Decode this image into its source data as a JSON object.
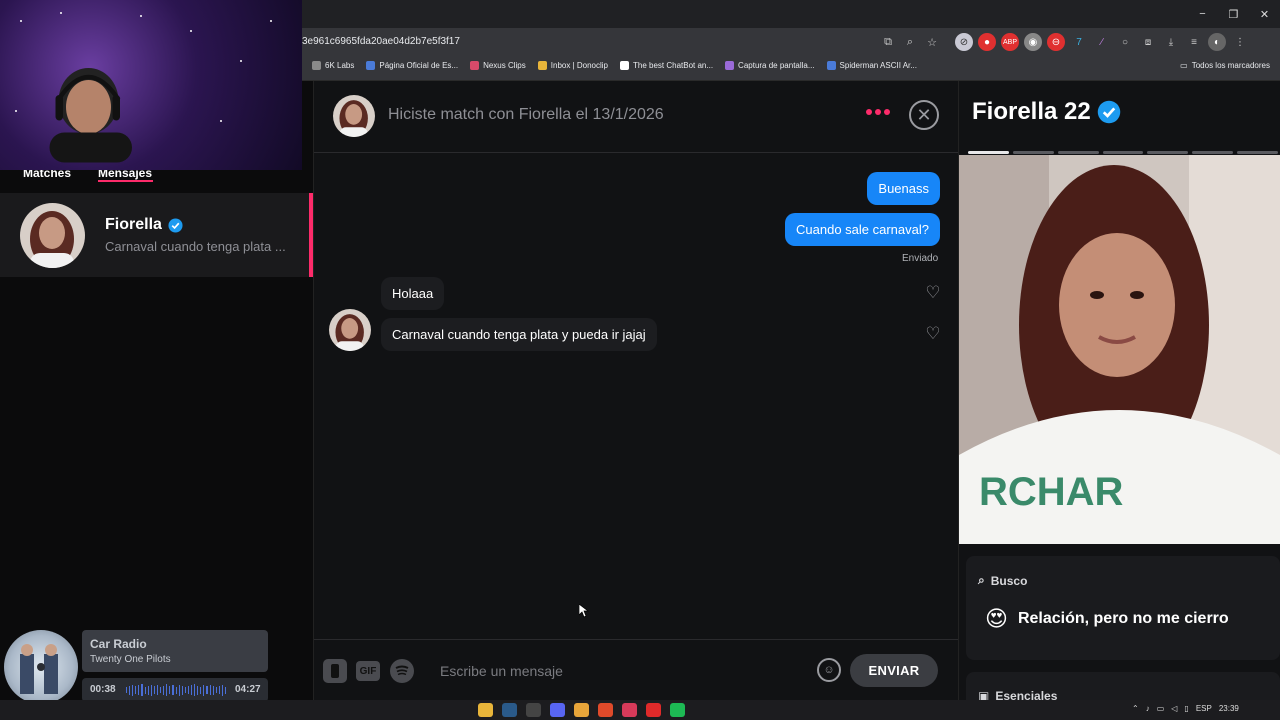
{
  "browser": {
    "url": "3e961c6965fda20ae04d2b7e5f3f17",
    "bookmarks": [
      {
        "label": "6K Labs",
        "color": "#8a8a8a"
      },
      {
        "label": "Página Oficial de Es...",
        "color": "#4a7bd8"
      },
      {
        "label": "Nexus Clips",
        "color": "#d84a6a"
      },
      {
        "label": "Inbox | Donoclip",
        "color": "#e8b53a"
      },
      {
        "label": "The best ChatBot an...",
        "color": "#ffffff"
      },
      {
        "label": "Captura de pantalla...",
        "color": "#9a6ad8"
      },
      {
        "label": "Spiderman ASCII Ar...",
        "color": "#4a7bd8"
      }
    ],
    "all_bookmarks": "Todos los marcadores",
    "window_controls": [
      "−",
      "❐",
      "✕"
    ]
  },
  "sidebar": {
    "tabs": {
      "matches": "Matches",
      "messages": "Mensajes"
    },
    "active_tab": "Mensajes",
    "conversation": {
      "name": "Fiorella",
      "verified": true,
      "preview": "Carnaval cuando tenga plata ..."
    }
  },
  "music": {
    "title": "Car Radio",
    "artist": "Twenty One Pilots",
    "current_time": "00:38",
    "total_time": "04:27",
    "progress": 0.14
  },
  "chat": {
    "header": "Hiciste match con Fiorella el 13/1/2026",
    "messages_out": [
      "Buenass",
      "Cuando sale carnaval?"
    ],
    "sent_status": "Enviado",
    "messages_in": [
      "Holaaa",
      "Carnaval cuando tenga plata y pueda ir jajaj"
    ],
    "composer": {
      "placeholder": "Escribe un mensaje",
      "send_label": "ENVIAR",
      "gif_label": "GIF"
    }
  },
  "profile": {
    "name_age": "Fiorella 22",
    "verified": true,
    "photo_count": 7,
    "active_photo": 0,
    "busco_label": "Busco",
    "busco_value": "Relación, pero no me cierro",
    "busco_emoji": "😍",
    "esenciales_label": "Esenciales"
  },
  "taskbar": {
    "language": "ESP",
    "time": "23:39"
  },
  "colors": {
    "accent": "#fd2b6a",
    "outgoing_bubble": "#1786f8",
    "verified": "#1d9bf0"
  }
}
